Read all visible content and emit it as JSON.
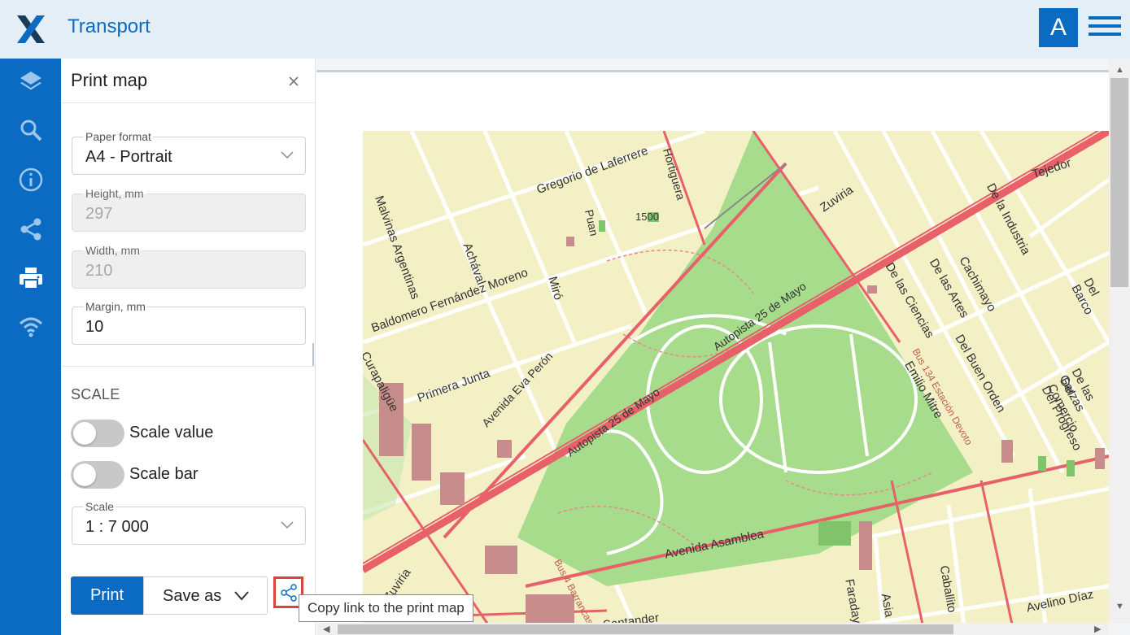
{
  "app": {
    "title": "Transport",
    "avatar_letter": "A",
    "brand_color": "#0b6bc2"
  },
  "sidebar": {
    "items": [
      {
        "icon": "layers-icon"
      },
      {
        "icon": "search-icon"
      },
      {
        "icon": "info-icon"
      },
      {
        "icon": "share-icon"
      },
      {
        "icon": "printer-icon",
        "active": true
      },
      {
        "icon": "wifi-icon"
      }
    ]
  },
  "panel": {
    "title": "Print map",
    "paper_format": {
      "label": "Paper format",
      "value": "A4 - Portrait"
    },
    "height": {
      "label": "Height, mm",
      "value": "297"
    },
    "width": {
      "label": "Width, mm",
      "value": "210"
    },
    "margin": {
      "label": "Margin, mm",
      "value": "10"
    },
    "scale_section": "SCALE",
    "scale_value_toggle": {
      "label": "Scale value",
      "on": false
    },
    "scale_bar_toggle": {
      "label": "Scale bar",
      "on": false
    },
    "scale": {
      "label": "Scale",
      "value": "1 : 7 000"
    },
    "print_label": "Print",
    "save_as_label": "Save as",
    "share_tooltip": "Copy link to the print map"
  },
  "map": {
    "street_labels": [
      "Gregorio de Laferrere",
      "Hortiguera",
      "Tejedor",
      "Zuviria",
      "De la Industria",
      "Malvinas Argentinas",
      "Achával",
      "Puan",
      "1500",
      "Miró",
      "Baldomero Fernández Moreno",
      "Autopista 25 de Mayo",
      "Autopista 25 de Mayo",
      "Avenida Eva Perón",
      "Primera Junta",
      "Curapaligüe",
      "De las Ciencias",
      "De las Artes",
      "Cachimayo",
      "Del Buen Orden",
      "Emilio Mitre",
      "Del Barco",
      "De las Garzas",
      "Del Comercio",
      "Del Progreso",
      "Avenida Asamblea",
      "Faraday",
      "Asia",
      "Caballito",
      "Avelino Díaz",
      "Santander",
      "Zuviria",
      "Bus 134 Estación Devoto",
      "Bus 4 Barrancas"
    ],
    "colors": {
      "land": "#f3f0c6",
      "park": "#a6dc8c",
      "major_road": "#e8606a",
      "street": "#ffffff",
      "building": "#c98c8c"
    }
  }
}
